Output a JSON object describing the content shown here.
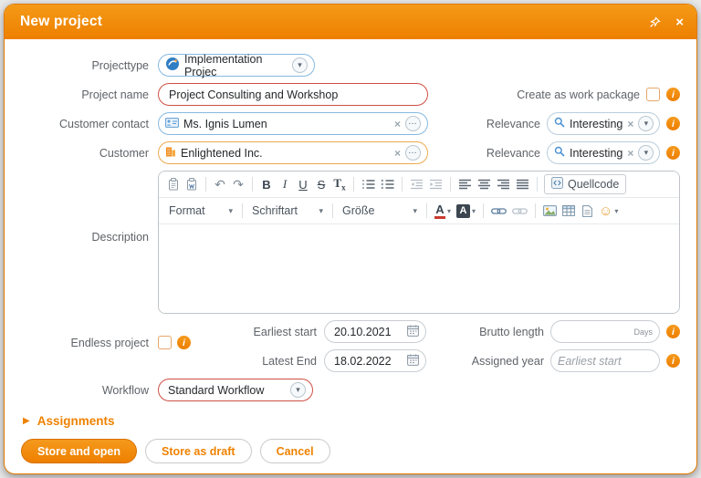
{
  "window": {
    "title": "New project"
  },
  "fields": {
    "projecttype": {
      "label": "Projecttype",
      "value": "Implementation Projec"
    },
    "project_name": {
      "label": "Project name",
      "value": "Project Consulting and Workshop"
    },
    "create_work_package": {
      "label": "Create as work package"
    },
    "customer_contact": {
      "label": "Customer contact",
      "value": "Ms. Ignis Lumen"
    },
    "relevance_contact": {
      "label": "Relevance",
      "value": "Interesting"
    },
    "customer": {
      "label": "Customer",
      "value": "Enlightened Inc."
    },
    "relevance_customer": {
      "label": "Relevance",
      "value": "Interesting"
    },
    "description": {
      "label": "Description"
    },
    "endless_project": {
      "label": "Endless project"
    },
    "earliest_start": {
      "label": "Earliest start",
      "value": "20.10.2021"
    },
    "latest_end": {
      "label": "Latest End",
      "value": "18.02.2022"
    },
    "brutto_length": {
      "label": "Brutto length",
      "unit": "Days"
    },
    "assigned_year": {
      "label": "Assigned year",
      "placeholder": "Earliest start"
    },
    "workflow": {
      "label": "Workflow",
      "value": "Standard Workflow"
    }
  },
  "editor": {
    "format_dropdown": "Format",
    "font_dropdown": "Schriftart",
    "size_dropdown": "Größe",
    "source_button": "Quellcode",
    "bold": "B",
    "italic": "I",
    "underline": "U",
    "strike": "S",
    "clear_format_main": "T",
    "clear_format_sub": "x",
    "color_letter": "A"
  },
  "icons": {
    "undo": "↶",
    "redo": "↷",
    "chevron_down": "▾",
    "clear": "×",
    "more": "…",
    "smiley": "☺",
    "close": "×",
    "info": "i",
    "expand_arrow": "▶"
  },
  "sections": {
    "assignments": "Assignments"
  },
  "buttons": {
    "store_and_open": "Store and open",
    "store_as_draft": "Store as draft",
    "cancel": "Cancel"
  },
  "colors": {
    "accent": "#ef8200",
    "required": "#cf4f44",
    "linked_blue": "#86b9e0",
    "linked_orange": "#eda94f"
  }
}
